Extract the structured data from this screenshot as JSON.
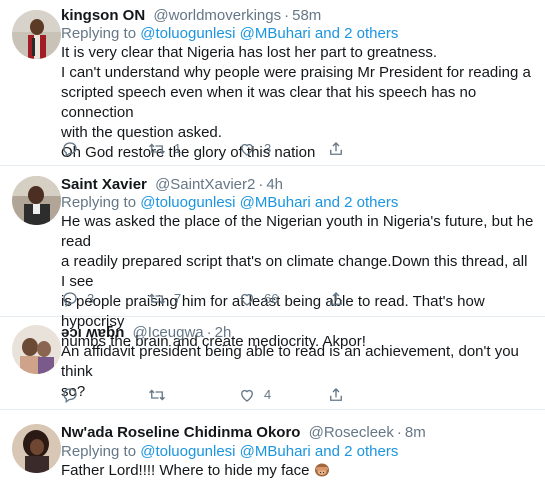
{
  "replying_prefix": "Replying to",
  "tweets": [
    {
      "name": "kingson ON",
      "handle": "@worldmoverkings",
      "time": "58m",
      "replying_to": "@toluogunlesi @MBuhari and 2 others",
      "lines": [
        "It is very clear that Nigeria has lost her part to greatness.",
        "I can't understand why people were praising Mr President for reading a",
        "scripted speech even when it was clear that his speech has no connection",
        "with the question asked.",
        "Oh God restore the glory of this nation"
      ],
      "retweets": "1",
      "likes": "3"
    },
    {
      "name": "Saint Xavier",
      "handle": "@SaintXavier2",
      "time": "4h",
      "replying_to": "@toluogunlesi @MBuhari and 2 others",
      "lines": [
        "He was asked the place of the Nigerian youth in Nigeria's future, but he read",
        "a readily prepared script that's on climate change.Down this thread, all I see",
        "is people praising him for at least being able to read. That's how hypocrisy",
        "numbs the brain and create mediocrity. Akpor!"
      ],
      "replies": "3",
      "retweets": "7",
      "likes": "66"
    },
    {
      "name": "ǝɔı ʍɐƃn",
      "handle": "@Iceugwa",
      "time": "2h",
      "lines": [
        "An affidavit president being able to read is an achievement, don't you think",
        "so?"
      ],
      "likes": "4"
    },
    {
      "name": "Nw'ada Roseline Chidinma Okoro",
      "handle": "@Rosecleek",
      "time": "8m",
      "replying_to": "@toluogunlesi @MBuhari and 2 others",
      "lines": [
        "Father Lord!!!! Where to hide my face"
      ],
      "emoji": "see-no-evil-monkey-icon"
    }
  ],
  "colors": {
    "text": "#14171a",
    "secondary": "#657786",
    "link": "#1b95e0",
    "divider": "#e6ecf0"
  }
}
